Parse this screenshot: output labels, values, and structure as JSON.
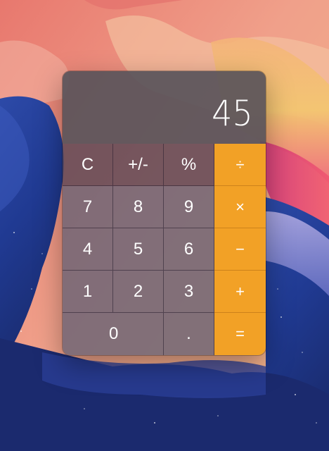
{
  "colors": {
    "operator_orange": "#f2a126",
    "key_text": "#ffffff"
  },
  "wallpaper": {
    "description_icon": "mountain-wallpaper-background"
  },
  "calculator": {
    "display_value": "45",
    "keys": {
      "clear": "C",
      "sign": "+/-",
      "percent": "%",
      "divide": "÷",
      "seven": "7",
      "eight": "8",
      "nine": "9",
      "multiply": "×",
      "four": "4",
      "five": "5",
      "six": "6",
      "subtract": "−",
      "one": "1",
      "two": "2",
      "three": "3",
      "add": "+",
      "zero": "0",
      "decimal": ".",
      "equals": "="
    }
  }
}
